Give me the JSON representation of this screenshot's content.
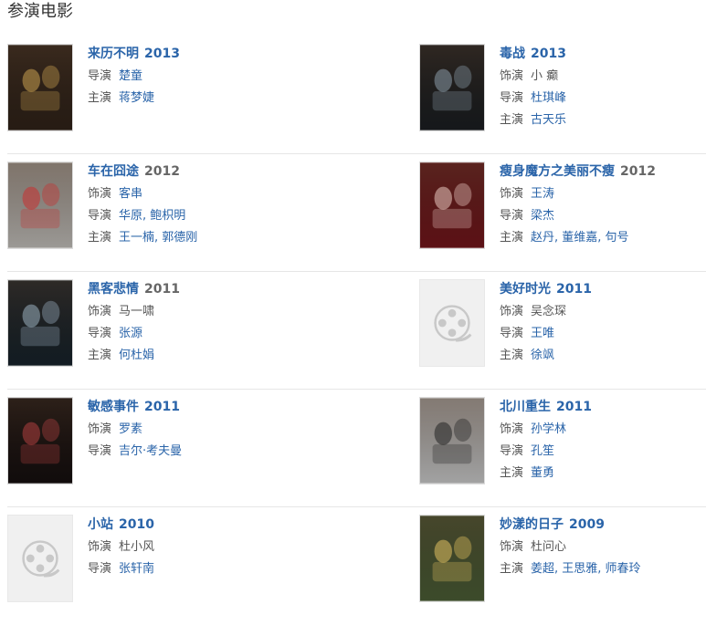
{
  "section": {
    "title": "参演电影"
  },
  "rows": [
    {
      "left": {
        "title": "来历不明",
        "year": "2013",
        "year_gray": false,
        "credits": [
          {
            "label": "导演",
            "names": "楚童",
            "gray": false
          },
          {
            "label": "主演",
            "names": "蒋梦婕",
            "gray": false
          }
        ]
      },
      "right": {
        "title": "毒战",
        "year": "2013",
        "year_gray": false,
        "credits": [
          {
            "label": "饰演",
            "names": "小 癫",
            "gray": true
          },
          {
            "label": "导演",
            "names": "杜琪峰",
            "gray": false
          },
          {
            "label": "主演",
            "names": "古天乐",
            "gray": false
          }
        ]
      }
    },
    {
      "left": {
        "title": "车在囧途",
        "year": "2012",
        "year_gray": true,
        "credits": [
          {
            "label": "饰演",
            "names": "客串",
            "gray": false
          },
          {
            "label": "导演",
            "names": "华原, 鲍枳明",
            "gray": false
          },
          {
            "label": "主演",
            "names": "王一楠, 郭德刚",
            "gray": false
          }
        ]
      },
      "right": {
        "title": "瘦身魔方之美丽不瘦",
        "year": "2012",
        "year_gray": true,
        "credits": [
          {
            "label": "饰演",
            "names": "王涛",
            "gray": false
          },
          {
            "label": "导演",
            "names": "梁杰",
            "gray": false
          },
          {
            "label": "主演",
            "names": "赵丹, 董维嘉, 句号",
            "gray": false
          }
        ]
      }
    },
    {
      "left": {
        "title": "黑客悲情",
        "year": "2011",
        "year_gray": true,
        "credits": [
          {
            "label": "饰演",
            "names": "马一啸",
            "gray": true
          },
          {
            "label": "导演",
            "names": "张源",
            "gray": false
          },
          {
            "label": "主演",
            "names": "何杜娟",
            "gray": false
          }
        ]
      },
      "right": {
        "title": "美好时光",
        "year": "2011",
        "year_gray": false,
        "credits": [
          {
            "label": "饰演",
            "names": "吴念琛",
            "gray": true
          },
          {
            "label": "导演",
            "names": "王唯",
            "gray": false
          },
          {
            "label": "主演",
            "names": "徐飒",
            "gray": false
          }
        ]
      }
    },
    {
      "left": {
        "title": "敏感事件",
        "year": "2011",
        "year_gray": false,
        "credits": [
          {
            "label": "饰演",
            "names": "罗素",
            "gray": false
          },
          {
            "label": "导演",
            "names": "吉尔·考夫曼",
            "gray": false
          }
        ]
      },
      "right": {
        "title": "北川重生",
        "year": "2011",
        "year_gray": false,
        "credits": [
          {
            "label": "饰演",
            "names": "孙学林",
            "gray": false
          },
          {
            "label": "导演",
            "names": "孔笙",
            "gray": false
          },
          {
            "label": "主演",
            "names": "董勇",
            "gray": false
          }
        ]
      }
    },
    {
      "left": {
        "title": "小站",
        "year": "2010",
        "year_gray": false,
        "credits": [
          {
            "label": "饰演",
            "names": "杜小风",
            "gray": true
          },
          {
            "label": "导演",
            "names": "张轩南",
            "gray": false
          }
        ]
      },
      "right": {
        "title": "妙漾的日子",
        "year": "2009",
        "year_gray": false,
        "credits": [
          {
            "label": "饰演",
            "names": "杜问心",
            "gray": true
          },
          {
            "label": "主演",
            "names": "姜超, 王思雅, 师春玲",
            "gray": false
          }
        ]
      }
    }
  ],
  "posters": {
    "r0l": {
      "kind": "image",
      "caption": "来历不明",
      "bg": "#3a2a1e",
      "accent": "#c8a050"
    },
    "r0r": {
      "kind": "image",
      "caption": "毒战",
      "bg": "#202428",
      "accent": "#8a9aa8"
    },
    "r1l": {
      "kind": "image",
      "caption": "车在囧途",
      "bg": "#e8e4de",
      "accent": "#c83030"
    },
    "r1r": {
      "kind": "image",
      "caption": "瘦身",
      "bg": "#8a1a20",
      "accent": "#e8c8c0"
    },
    "r2l": {
      "kind": "image",
      "caption": "黑客悲情",
      "bg": "#1c2a34",
      "accent": "#9ab0c0"
    },
    "r2r": {
      "kind": "placeholder"
    },
    "r3l": {
      "kind": "image",
      "caption": "敏感事件",
      "bg": "#1a1212",
      "accent": "#b04040"
    },
    "r3r": {
      "kind": "image",
      "caption": "北川重生",
      "bg": "#f2f2f2",
      "accent": "#222222"
    },
    "r4l": {
      "kind": "placeholder"
    },
    "r4r": {
      "kind": "image",
      "caption": "妙漾的日子",
      "bg": "#5a7040",
      "accent": "#e0c060"
    }
  }
}
